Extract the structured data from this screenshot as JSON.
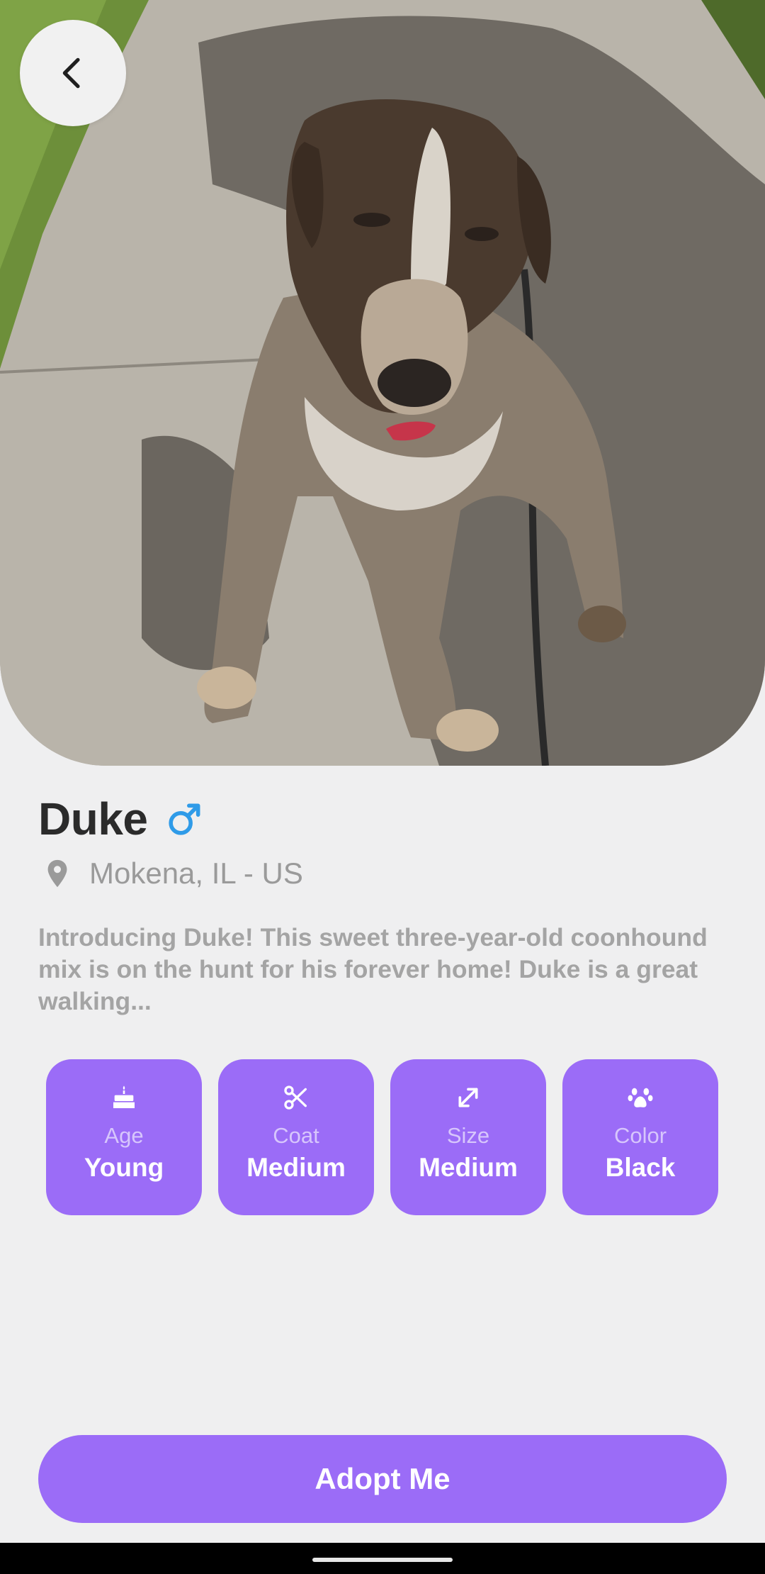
{
  "pet": {
    "name": "Duke",
    "gender_icon": "male-symbol-icon",
    "location": "Mokena, IL - US",
    "description": "Introducing Duke! This sweet three-year-old coonhound mix is on the hunt for his forever home! Duke is a great walking..."
  },
  "traits": [
    {
      "icon": "cake-icon",
      "label": "Age",
      "value": "Young"
    },
    {
      "icon": "scissors-icon",
      "label": "Coat",
      "value": "Medium"
    },
    {
      "icon": "resize-arrows-icon",
      "label": "Size",
      "value": "Medium"
    },
    {
      "icon": "paw-icon",
      "label": "Color",
      "value": "Black"
    }
  ],
  "actions": {
    "adopt_label": "Adopt Me"
  },
  "colors": {
    "accent": "#9b6cf7",
    "gender_male": "#2f9be8",
    "background": "#efeff0"
  }
}
